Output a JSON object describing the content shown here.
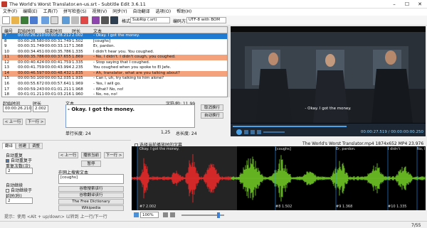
{
  "window": {
    "title": "The World's Worst Translator.en-us.srt - Subtitle Edit 3.6.11"
  },
  "menu": [
    "文件(F)",
    "编辑(E)",
    "工具(T)",
    "拼写检查(S)",
    "视频(V)",
    "同步(Y)",
    "自动翻译",
    "选项(O)",
    "帮助(H)"
  ],
  "toolbar": {
    "format_label": "格式",
    "format_value": "SubRip (.srt)",
    "encoding_label": "编码方式",
    "encoding_value": "UTF-8 with BOM"
  },
  "grid": {
    "headers": [
      "编号",
      "起始时间",
      "结束时间",
      "时长",
      "文本"
    ],
    "rows": [
      {
        "n": "7",
        "start": "00:00:26.210",
        "end": "00:00:28.212",
        "dur": "2.002",
        "text": "- Okay. I got the money."
      },
      {
        "n": "8",
        "start": "00:00:28.580",
        "end": "00:00:31.749",
        "dur": "1.502",
        "text": "[coughs]"
      },
      {
        "n": "9",
        "start": "00:00:31.749",
        "end": "00:00:33.117",
        "dur": "1.368",
        "text": "Er, pardon."
      },
      {
        "n": "10",
        "start": "00:00:34.451",
        "end": "00:00:35.786",
        "dur": "1.335",
        "text": "I didn't hear you. You coughed."
      },
      {
        "n": "11",
        "start": "00:00:35.786",
        "end": "00:00:37.655",
        "dur": "1.869",
        "text": "- No, I didn't. I didn't cough, you coughed."
      },
      {
        "n": "12",
        "start": "00:00:40.424",
        "end": "00:00:41.759",
        "dur": "1.335",
        "text": "- Stop saying that I coughed."
      },
      {
        "n": "13",
        "start": "00:00:41.759",
        "end": "00:00:43.994",
        "dur": "2.235",
        "text": "You coughed when you spoke to El Jefe."
      },
      {
        "n": "14",
        "start": "00:00:46.597",
        "end": "00:00:48.432",
        "dur": "1.835",
        "text": "- Ah, translator, what are you talking about?"
      },
      {
        "n": "15",
        "start": "00:00:50.100",
        "end": "00:00:52.035",
        "dur": "1.935",
        "text": "- Can I, uh, try talking to him alone?"
      },
      {
        "n": "16",
        "start": "00:00:55.672",
        "end": "00:00:57.641",
        "dur": "1.969",
        "text": "- Yes, I will go."
      },
      {
        "n": "17",
        "start": "00:00:59.243",
        "end": "00:01:01.211",
        "dur": "1.968",
        "text": "- What? No, no!"
      },
      {
        "n": "18",
        "start": "00:01:01.211",
        "end": "00:01:03.216",
        "dur": "1.960",
        "text": "- No, no, no!"
      }
    ]
  },
  "edit": {
    "start_label": "起始时间",
    "dur_label": "时长",
    "text_label": "文本",
    "start_value": "00:00:26.210",
    "dur_value": "2.002",
    "char_label": "字符/秒: 11.99",
    "text_value": "- Okay. I got the money.",
    "single_line_len": "单行长度: 24",
    "total_len": "总长度: 24",
    "pos": "1,25",
    "prev_btn": "< 上一行",
    "next_btn": "下一行 >",
    "unbreak_btn": "取消换行",
    "autobreak_btn": "自动换行"
  },
  "video": {
    "subtitle": "- Okay. I got the money.",
    "time": "00:00:27.519 / 00:00:00:00.250"
  },
  "lower": {
    "tabs": [
      "翻译",
      "创建",
      "调整"
    ],
    "auto_repeat": "自动重复",
    "auto_repeat_on": "自动重复于",
    "repeat_count_label": "重复次数(次)",
    "repeat_count": "2",
    "auto_continue": "自动继续",
    "auto_continue_on": "自动继续于",
    "delay_label": "延时(秒)",
    "delay_value": "2",
    "prev_btn": "< 上一行",
    "play_cur_btn": "播放当前",
    "next_btn": "下一行 >",
    "pause_btn": "暂停",
    "search_label": "在网上搜索文本",
    "search_value": "[coughs]",
    "google_it": "谷歌搜索该行",
    "google_translate": "谷歌翻译该行",
    "free_dict": "The Free Dictionary",
    "wikipedia": "Wikipedia",
    "hint": "提示：使用 <Alt + up/down> 以转到 上一行/下一行"
  },
  "waveform": {
    "checkbox_label": "选择当前播放时的字幕",
    "video_info": "The World's Worst Translator.mp4 1874x652 MP4 23.976",
    "zoom": "100%",
    "seg_labels": [
      "Okay. I got the money.",
      "[coughs]",
      "Er, pardon.",
      "I didn't",
      "No, I"
    ],
    "seg_nums": [
      "#7 2.002",
      "#8 1.502",
      "#9 1.368",
      "#10 1.335"
    ]
  },
  "status": {
    "line": "7/55"
  },
  "colors": {
    "selected": "#1f7ad1",
    "error_row": "#f4a27c",
    "wave_red": "#ff2a2a",
    "wave_green": "#7ddf2a"
  }
}
